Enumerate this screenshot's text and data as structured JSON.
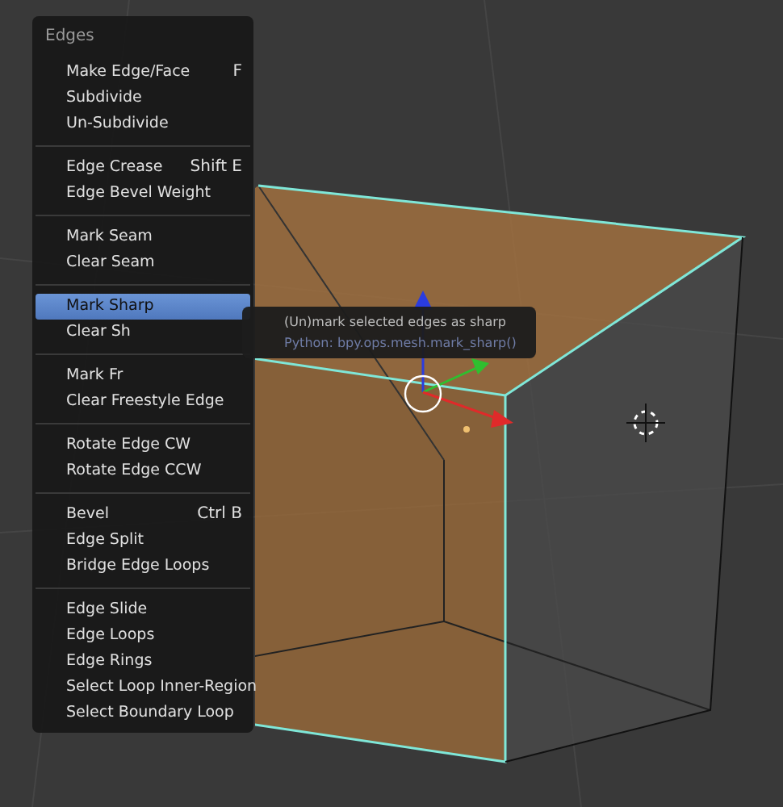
{
  "menu": {
    "title": "Edges",
    "sections": [
      [
        {
          "label": "Make Edge/Face",
          "shortcut": "F",
          "selected": false
        },
        {
          "label": "Subdivide",
          "selected": false
        },
        {
          "label": "Un-Subdivide",
          "selected": false
        }
      ],
      [
        {
          "label": "Edge Crease",
          "shortcut": "Shift E",
          "selected": false
        },
        {
          "label": "Edge Bevel Weight",
          "selected": false
        }
      ],
      [
        {
          "label": "Mark Seam",
          "selected": false
        },
        {
          "label": "Clear Seam",
          "selected": false
        }
      ],
      [
        {
          "label": "Mark Sharp",
          "selected": true
        },
        {
          "label": "Clear Sh",
          "selected": false
        }
      ],
      [
        {
          "label": "Mark Fr",
          "selected": false
        },
        {
          "label": "Clear Freestyle Edge",
          "selected": false
        }
      ],
      [
        {
          "label": "Rotate Edge CW",
          "selected": false
        },
        {
          "label": "Rotate Edge CCW",
          "selected": false
        }
      ],
      [
        {
          "label": "Bevel",
          "shortcut": "Ctrl B",
          "selected": false
        },
        {
          "label": "Edge Split",
          "selected": false
        },
        {
          "label": "Bridge Edge Loops",
          "selected": false
        }
      ],
      [
        {
          "label": "Edge Slide",
          "selected": false
        },
        {
          "label": "Edge Loops",
          "selected": false
        },
        {
          "label": "Edge Rings",
          "selected": false
        },
        {
          "label": "Select Loop Inner-Region",
          "selected": false
        },
        {
          "label": "Select Boundary Loop",
          "selected": false
        }
      ]
    ]
  },
  "tooltip": {
    "description": "(Un)mark selected edges as sharp",
    "python": "Python: bpy.ops.mesh.mark_sharp()"
  }
}
